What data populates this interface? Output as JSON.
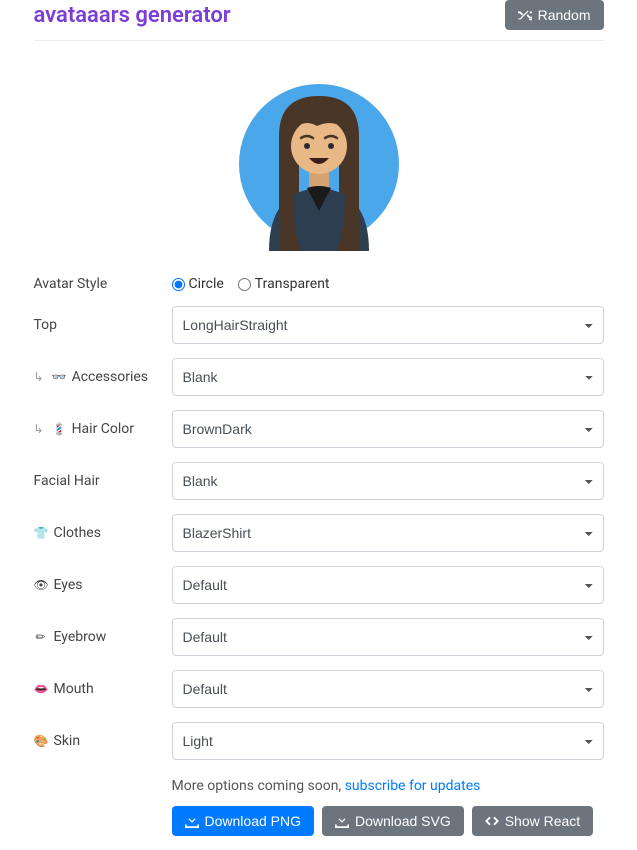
{
  "header": {
    "title": "avataaars generator",
    "random_label": "Random"
  },
  "avatar_style": {
    "label": "Avatar Style",
    "options": {
      "circle": "Circle",
      "transparent": "Transparent"
    },
    "value": "circle"
  },
  "fields": {
    "top": {
      "label": "Top",
      "value": "LongHairStraight",
      "indent": false,
      "icon": ""
    },
    "accessories": {
      "label": "Accessories",
      "value": "Blank",
      "indent": true,
      "icon": "👓"
    },
    "hair_color": {
      "label": "Hair Color",
      "value": "BrownDark",
      "indent": true,
      "icon": "💈"
    },
    "facial_hair": {
      "label": "Facial Hair",
      "value": "Blank",
      "indent": false,
      "icon": ""
    },
    "clothes": {
      "label": "Clothes",
      "value": "BlazerShirt",
      "indent": false,
      "icon": "👕"
    },
    "eyes": {
      "label": "Eyes",
      "value": "Default",
      "indent": false,
      "icon": "👁"
    },
    "eyebrow": {
      "label": "Eyebrow",
      "value": "Default",
      "indent": false,
      "icon": "✏"
    },
    "mouth": {
      "label": "Mouth",
      "value": "Default",
      "indent": false,
      "icon": "👄"
    },
    "skin": {
      "label": "Skin",
      "value": "Light",
      "indent": false,
      "icon": "🎨"
    }
  },
  "footer": {
    "more_text": "More options coming soon, ",
    "subscribe_text": "subscribe for updates",
    "download_png": "Download PNG",
    "download_svg": "Download SVG",
    "show_react": "Show React"
  },
  "colors": {
    "accent": "#7b3ed6",
    "primary": "#007bff",
    "secondary": "#6c757d"
  }
}
